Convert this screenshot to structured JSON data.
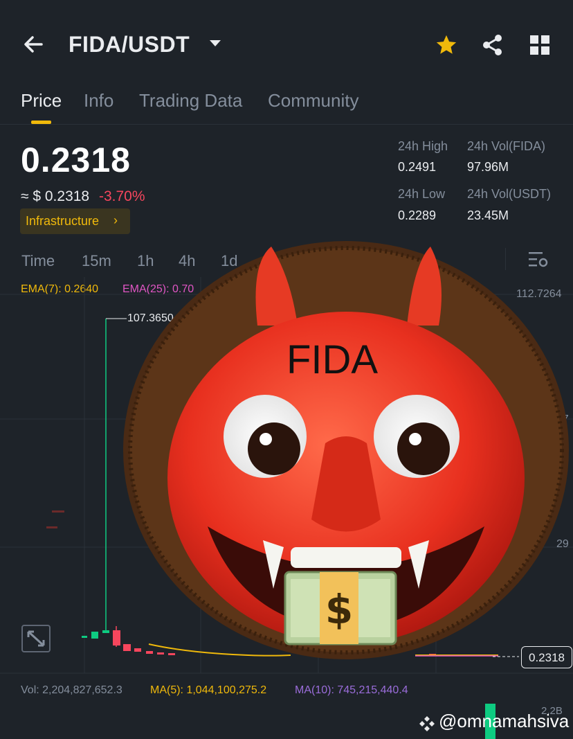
{
  "header": {
    "pair": "FIDA/USDT"
  },
  "tabs": [
    "Price",
    "Info",
    "Trading Data",
    "Community"
  ],
  "ticker": {
    "last_price": "0.2318",
    "fiat_price": "≈ $ 0.2318",
    "change_pct": "-3.70%",
    "tag": "Infrastructure",
    "high_label": "24h High",
    "high_value": "0.2491",
    "low_label": "24h Low",
    "low_value": "0.2289",
    "vol_base_label": "24h Vol(FIDA)",
    "vol_base_value": "97.96M",
    "vol_quote_label": "24h Vol(USDT)",
    "vol_quote_value": "23.45M"
  },
  "timeframes": [
    "Time",
    "15m",
    "1h",
    "4h",
    "1d"
  ],
  "indicators": {
    "ema7": "EMA(7): 0.2640",
    "ema25": "EMA(25): 0.70"
  },
  "chart": {
    "axis_top": "112.7264",
    "axis_mid1": "97",
    "axis_mid2": "29",
    "peak_label": "107.3650",
    "current_price": "0.2318"
  },
  "volume": {
    "vol": "Vol: 2,204,827,652.3",
    "ma5": "MA(5): 1,044,100,275.2",
    "ma10": "MA(10): 745,215,440.4",
    "axis": "2.2B"
  },
  "overlay": {
    "sticker_text": "FIDA",
    "watermark": "@omnamahsiva"
  },
  "colors": {
    "bg": "#1e2329",
    "accent": "#f0b90b",
    "up": "#0ecb81",
    "down": "#f6465d",
    "muted": "#848e9c"
  }
}
